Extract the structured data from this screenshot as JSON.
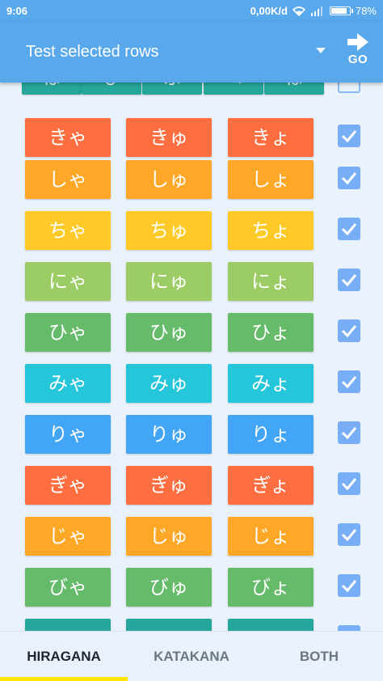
{
  "status_bar": {
    "time": "9:06",
    "net_speed": "0,00K/d",
    "battery_percent": "78%",
    "battery_level": 0.78
  },
  "app_bar": {
    "mode_label": "Test selected rows",
    "go_label": "GO"
  },
  "rows": [
    {
      "kana": [
        "は",
        "ひ",
        "ふ",
        "へ",
        "ほ"
      ],
      "checked": false,
      "color": "#26a69a",
      "partial": true
    },
    {
      "kana": [
        "きゃ",
        "きゅ",
        "きょ"
      ],
      "checked": true,
      "color": "#ff6e40"
    },
    {
      "kana": [
        "しゃ",
        "しゅ",
        "しょ"
      ],
      "checked": true,
      "color": "#ffa726"
    },
    {
      "kana": [
        "ちゃ",
        "ちゅ",
        "ちょ"
      ],
      "checked": true,
      "color": "#ffca28"
    },
    {
      "kana": [
        "にゃ",
        "にゅ",
        "にょ"
      ],
      "checked": true,
      "color": "#9ccc65"
    },
    {
      "kana": [
        "ひゃ",
        "ひゅ",
        "ひょ"
      ],
      "checked": true,
      "color": "#66bb6a"
    },
    {
      "kana": [
        "みゃ",
        "みゅ",
        "みょ"
      ],
      "checked": true,
      "color": "#26c6da"
    },
    {
      "kana": [
        "りゃ",
        "りゅ",
        "りょ"
      ],
      "checked": true,
      "color": "#42a5f5"
    },
    {
      "kana": [
        "ぎゃ",
        "ぎゅ",
        "ぎょ"
      ],
      "checked": true,
      "color": "#ff6e40"
    },
    {
      "kana": [
        "じゃ",
        "じゅ",
        "じょ"
      ],
      "checked": true,
      "color": "#ffa726"
    },
    {
      "kana": [
        "びゃ",
        "びゅ",
        "びょ"
      ],
      "checked": true,
      "color": "#66bb6a"
    },
    {
      "kana": [
        "",
        "",
        ""
      ],
      "checked": true,
      "color": "#26a69a"
    }
  ],
  "tabs": [
    {
      "label": "HIRAGANA",
      "active": true
    },
    {
      "label": "KATAKANA",
      "active": false
    },
    {
      "label": "BOTH",
      "active": false
    }
  ],
  "colors": {
    "app_bar": "#5aa8ec",
    "background": "#e9f2fb",
    "checkbox": "#78aef5",
    "tab_indicator": "#ffe600"
  }
}
